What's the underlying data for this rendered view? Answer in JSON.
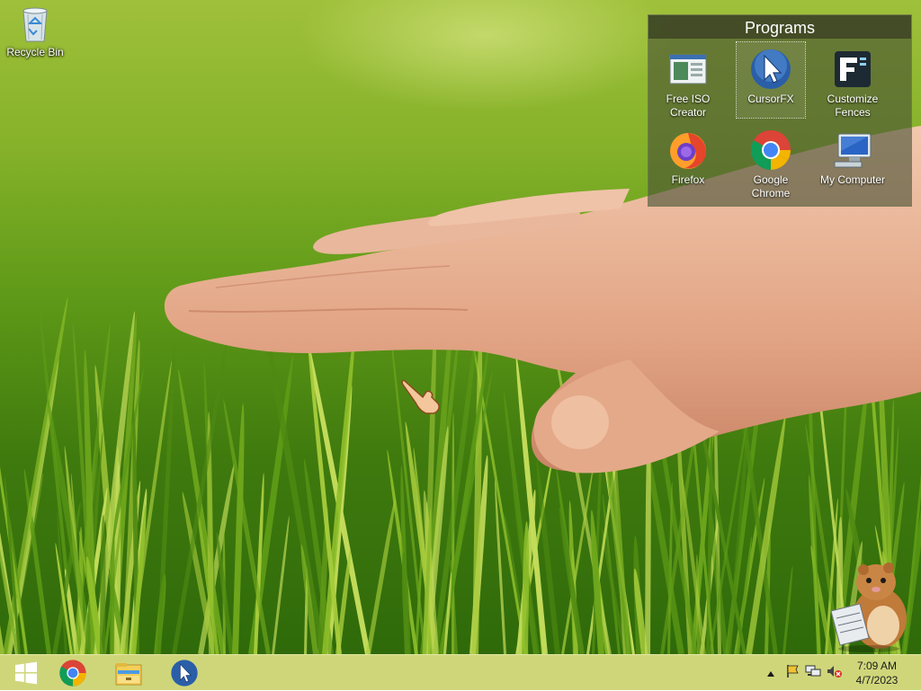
{
  "desktop": {
    "icons": [
      {
        "label": "Recycle Bin",
        "icon": "recycle-bin-icon"
      }
    ]
  },
  "fence": {
    "title": "Programs",
    "items": [
      {
        "label": "Free ISO Creator",
        "icon": "free-iso-creator-icon"
      },
      {
        "label": "CursorFX",
        "icon": "cursorfx-icon",
        "selected": true
      },
      {
        "label": "Customize Fences",
        "icon": "customize-fences-icon"
      },
      {
        "label": "Firefox",
        "icon": "firefox-icon"
      },
      {
        "label": "Google Chrome",
        "icon": "chrome-icon"
      },
      {
        "label": "My Computer",
        "icon": "my-computer-icon"
      }
    ]
  },
  "taskbar": {
    "pinned": [
      {
        "icon": "windows-start-icon"
      },
      {
        "icon": "chrome-icon"
      },
      {
        "icon": "file-explorer-icon"
      },
      {
        "icon": "cursorfx-icon"
      }
    ],
    "tray": {
      "show_hidden_icon": "chevron-up-icon",
      "icons": [
        "action-center-flag-icon",
        "network-icon",
        "volume-muted-icon"
      ]
    },
    "clock": {
      "time": "7:09 AM",
      "date": "4/7/2023"
    }
  },
  "colors": {
    "taskbar": "#cfd67a",
    "fence_background": "#485034",
    "fence_header": "#373e22",
    "grass_light": "#9fc03a",
    "grass_dark": "#2f6a0a",
    "skin": "#e8b69a"
  }
}
